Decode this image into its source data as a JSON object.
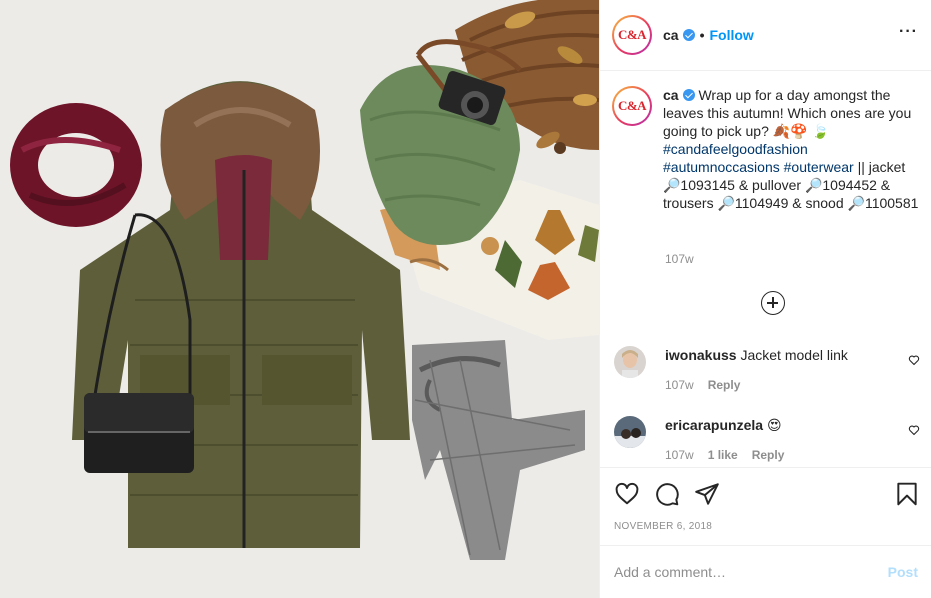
{
  "post": {
    "photo_alt": "C&A autumn outfit flat-lay",
    "brand_logo": "C&A"
  },
  "header": {
    "username": "ca",
    "separator": "•",
    "follow_label": "Follow",
    "more_label": "···"
  },
  "caption": {
    "username": "ca",
    "text_1": "Wrap up for a day amongst the leaves this autumn! Which ones are you going to pick up? 🍂🍄",
    "leaf_emoji": "🍃",
    "hashtag_1": "#candafeelgoodfashion",
    "hashtag_2": "#autumnoccasions",
    "hashtag_3": "#outerwear",
    "text_2": " || jacket 🔎1093145 & pullover 🔎1094452 & trousers 🔎1104949 & snood 🔎1100581",
    "time": "107w"
  },
  "comments": [
    {
      "username": "iwonakuss",
      "text": "Jacket model link",
      "time": "107w",
      "likes": "",
      "reply_label": "Reply"
    },
    {
      "username": "ericarapunzela",
      "text": "😍",
      "time": "107w",
      "likes": "1 like",
      "reply_label": "Reply"
    }
  ],
  "actions": {
    "date": "NOVEMBER 6, 2018"
  },
  "add_comment": {
    "placeholder": "Add a comment…",
    "post_label": "Post"
  },
  "colors": {
    "accent": "#0095f6",
    "post_disabled": "#b2dffc",
    "brand_red": "#d9262e",
    "muted": "#8e8e8e",
    "hashtag": "#00376b"
  }
}
